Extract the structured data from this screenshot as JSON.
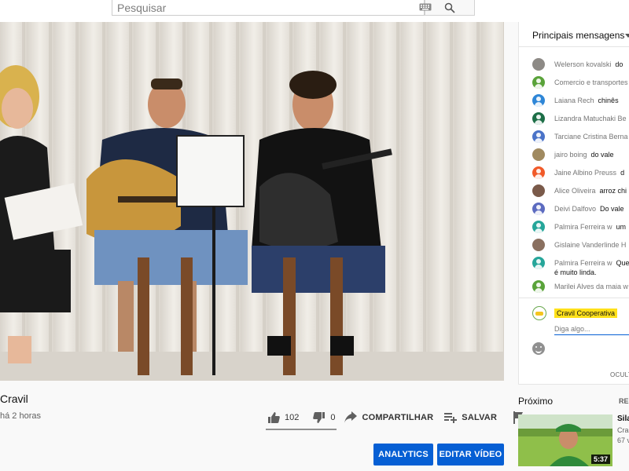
{
  "search": {
    "placeholder": "Pesquisar"
  },
  "video": {
    "title": "Cravil",
    "time_ago": "há 2 horas",
    "likes": "102",
    "dislikes": "0",
    "share_label": "COMPARTILHAR",
    "save_label": "SALVAR",
    "analytics_label": "ANALYTICS",
    "edit_label": "EDITAR VÍDEO"
  },
  "chat": {
    "header_title": "Principais mensagens",
    "messages": [
      {
        "author": "Welerson kovalski",
        "text": "do",
        "avatar_color": "#8d8a86"
      },
      {
        "author": "Comercio e transportes",
        "text": "",
        "avatar_color": "#5aa33a"
      },
      {
        "author": "Laiana Rech",
        "text": "chinês",
        "avatar_color": "#2e86d7"
      },
      {
        "author": "Lizandra Matuchaki Be",
        "text": "",
        "avatar_color": "#1d6e47"
      },
      {
        "author": "Tarciane Cristina Berna",
        "text": "",
        "avatar_color": "#4a73c8"
      },
      {
        "author": "jairo boing",
        "text": "do vale",
        "avatar_color": "#a08a60"
      },
      {
        "author": "Jaine Albino Preuss",
        "text": "d",
        "avatar_color": "#f15a29"
      },
      {
        "author": "Alice Oliveira",
        "text": "arroz chi",
        "avatar_color": "#7a5a4a"
      },
      {
        "author": "Deivi Dalfovo",
        "text": "Do vale",
        "avatar_color": "#5c6bc0"
      },
      {
        "author": "Palmira Ferreira w",
        "text": "um",
        "avatar_color": "#26a69a"
      },
      {
        "author": "Gislaine Vanderlinde H",
        "text": "",
        "avatar_color": "#8a7060"
      },
      {
        "author": "Palmira Ferreira w",
        "text": "Que",
        "text2": "é muito linda.",
        "avatar_color": "#26a69a"
      },
      {
        "author": "Marilei Alves da maia w",
        "text": "",
        "avatar_color": "#5aa33a"
      }
    ],
    "me_name": "Cravil Cooperativa",
    "input_placeholder": "Diga algo...",
    "hide_label": "OCULTA"
  },
  "up_next": {
    "label": "Próximo",
    "more_label": "RE",
    "title": "Sila",
    "channel": "Cra",
    "views": "67 v",
    "duration": "5:37"
  },
  "colors": {
    "accent": "#065fd4",
    "highlight": "#ffe11a"
  },
  "icons": [
    "keyboard-icon",
    "search-icon",
    "like-icon",
    "dislike-icon",
    "share-icon",
    "save-playlist-icon",
    "flag-icon",
    "emoji-icon"
  ]
}
